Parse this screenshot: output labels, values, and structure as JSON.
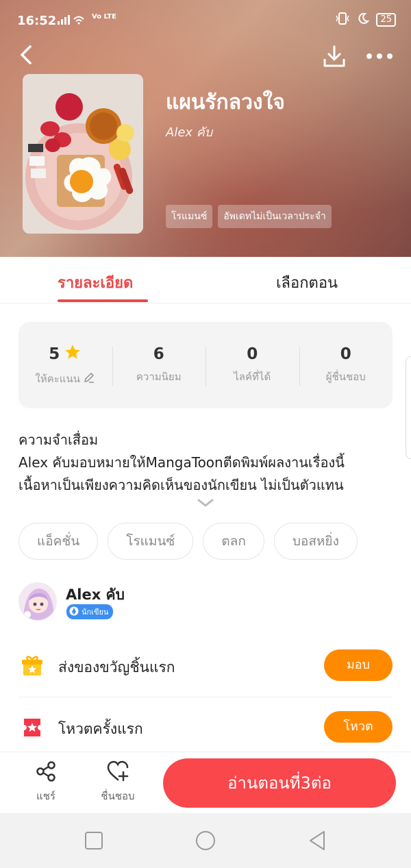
{
  "status_bar": {
    "time": "16:52",
    "signal": "Vo LTE",
    "battery": "25"
  },
  "header": {
    "title": "แผนรักลวงใจ",
    "author": "Alex คับ",
    "tags": [
      "โรแมนซ์",
      "อัพเดทไม่เป็นเวลาประจำ"
    ],
    "icons": {
      "back": "back-arrow-icon",
      "download": "download-icon",
      "more": "more-dots-icon"
    }
  },
  "tabs": [
    {
      "label": "รายละเอียด",
      "active": true
    },
    {
      "label": "เลือกตอน",
      "active": false
    }
  ],
  "stats": [
    {
      "value": "5",
      "label": "ให้คะแนน",
      "icon": "star-icon",
      "label_icon": "pencil-icon"
    },
    {
      "value": "6",
      "label": "ความนิยม"
    },
    {
      "value": "0",
      "label": "ไลค์ที่ได้"
    },
    {
      "value": "0",
      "label": "ผู้ชื่นชอบ"
    }
  ],
  "description": {
    "lines": [
      "ความจำเสื่อม",
      "Alex คับมอบหมายให้MangaToonตีดพิมพ์ผลงานเรื่องนี้",
      "เนื้อหาเป็นเพียงความคิดเห็นของนักเขียน ไม่เป็นตัวแทน"
    ]
  },
  "genres": [
    "แอ็คชั่น",
    "โรแมนซ์",
    "ตลก",
    "บอสหยิ่ง"
  ],
  "author": {
    "name": "Alex คับ",
    "badge": "นักเขียน"
  },
  "actions": {
    "gift": {
      "label": "ส่งของขวัญชิ้นแรก",
      "button": "มอบ"
    },
    "vote": {
      "label": "โหวตครั้งแรก",
      "button": "โหวต"
    }
  },
  "bottom_bar": {
    "share": "แชร์",
    "like": "ชื่นชอบ",
    "read": "อ่านตอนที่3ต่อ"
  },
  "colors": {
    "accent": "#f9474b",
    "tab_active": "#e84a4a",
    "orange": "#ff8a00",
    "star": "#ffc107",
    "badge_blue": "#3c8ef0"
  }
}
